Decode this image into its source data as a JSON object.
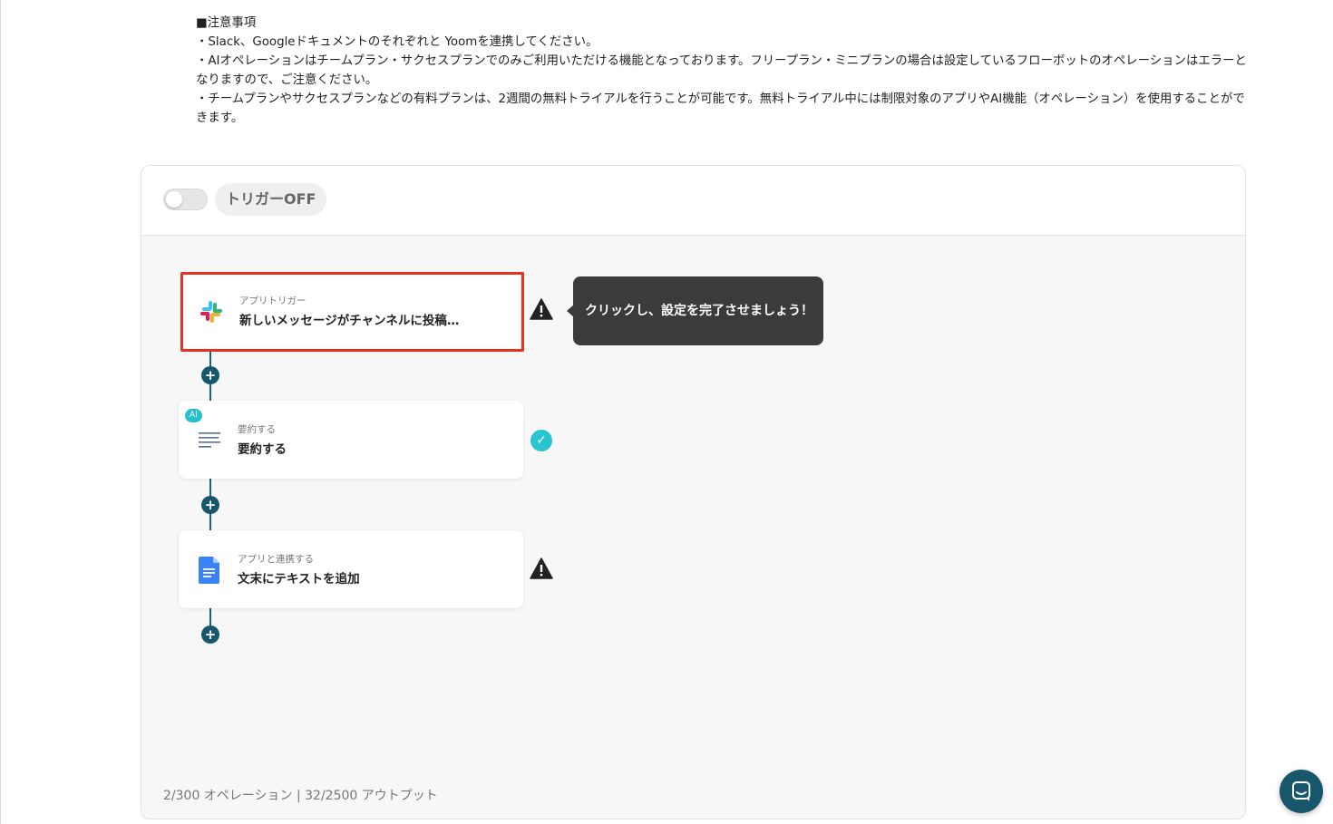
{
  "notes": {
    "heading": "■注意事項",
    "lines": [
      "・Slack、Googleドキュメントのそれぞれと Yoomを連携してください。",
      "・AIオペレーションはチームプラン・サクセスプランでのみご利用いただける機能となっております。フリープラン・ミニプランの場合は設定しているフローボットのオペレーションはエラーとなりますので、ご注意ください。",
      "・チームプランやサクセスプランなどの有料プランは、2週間の無料トライアルを行うことが可能です。無料トライアル中には制限対象のアプリやAI機能（オペレーション）を使用することができます。"
    ]
  },
  "flow": {
    "trigger_label": "トリガーOFF",
    "trigger_on": false,
    "steps": [
      {
        "sub": "アプリトリガー",
        "title": "新しいメッセージがチャンネルに投稿…",
        "icon": "slack-icon",
        "status": "warning",
        "highlighted": true
      },
      {
        "sub": "要約する",
        "title": "要約する",
        "icon": "summary-lines-icon",
        "badge": "AI",
        "status": "complete"
      },
      {
        "sub": "アプリと連携する",
        "title": "文末にテキストを追加",
        "icon": "google-docs-icon",
        "status": "warning"
      }
    ],
    "add_symbol": "+",
    "tooltip": "クリックし、設定を完了させましょう！",
    "stats": "2/300 オペレーション | 32/2500 アウトプット"
  },
  "colors": {
    "accent": "#17566b",
    "highlight": "#e8321f",
    "complete": "#2ac4d1",
    "tooltip_bg": "#3b3b3b"
  },
  "chat": {
    "icon": "chat-icon"
  }
}
